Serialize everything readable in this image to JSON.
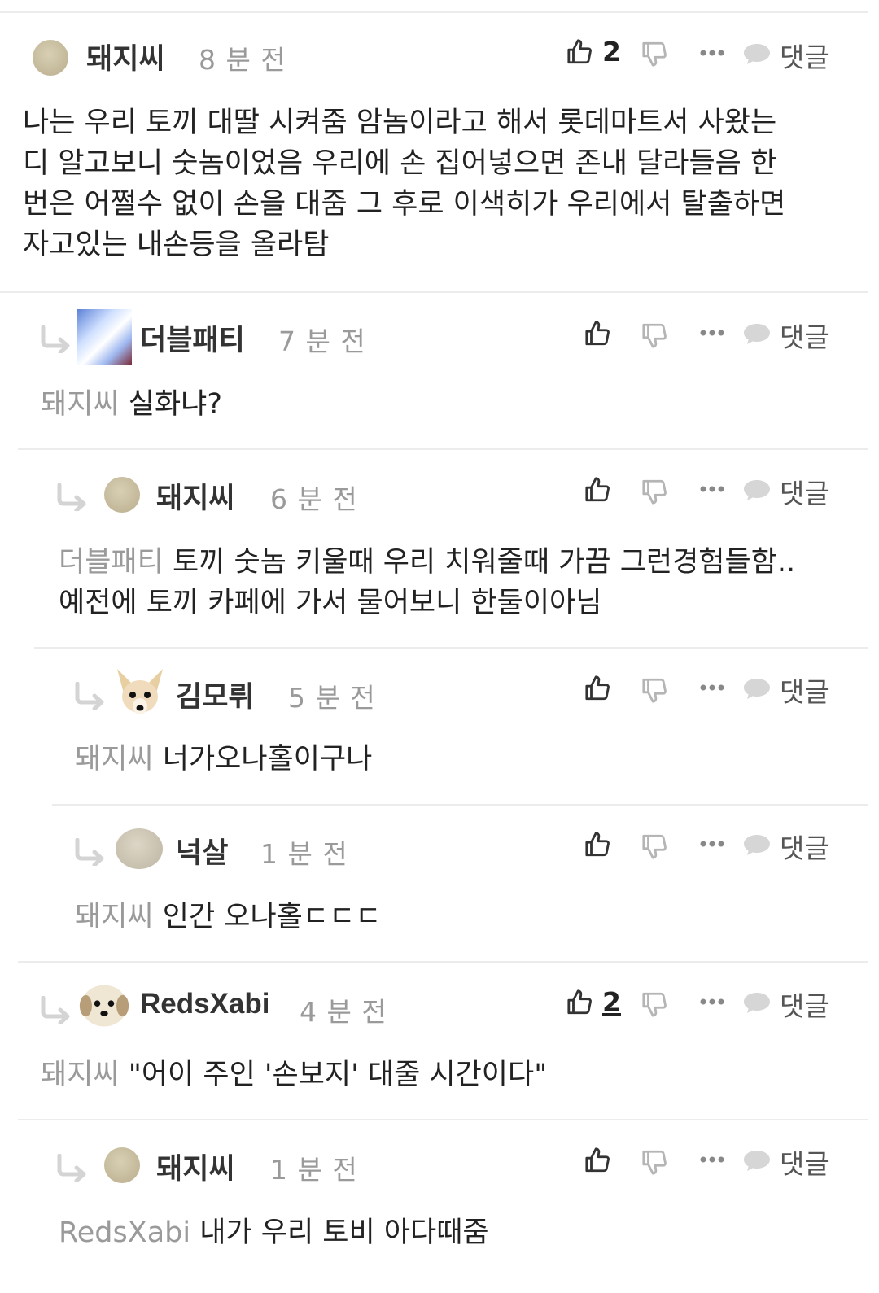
{
  "reply_label": "댓글",
  "comments": [
    {
      "user": "돼지씨",
      "time": "8 분 전",
      "likes": "2",
      "mention": "",
      "text": "나는 우리 토끼 대딸 시켜줌 암놈이라고 해서 롯데마트서 사왔는\n디 알고보니 숫놈이었음 우리에 손 집어넣으면 존내 달라들음 한\n번은 어쩔수 없이 손을 대줌 그 후로 이색히가 우리에서 탈출하면\n자고있는 내손등을 올라탐"
    },
    {
      "user": "더블패티",
      "time": "7 분 전",
      "likes": "",
      "mention": "돼지씨",
      "text": "실화냐?"
    },
    {
      "user": "돼지씨",
      "time": "6 분 전",
      "likes": "",
      "mention": "더블패티",
      "text": "토끼 숫놈 키울때 우리 치워줄때 가끔 그런경험들함..\n예전에 토끼 카페에 가서 물어보니 한둘이아님"
    },
    {
      "user": "김모뤼",
      "time": "5 분 전",
      "likes": "",
      "mention": "돼지씨",
      "text": "너가오나홀이구나"
    },
    {
      "user": "넉살",
      "time": "1 분 전",
      "likes": "",
      "mention": "돼지씨",
      "text": "인간 오나홀ㄷㄷㄷ"
    },
    {
      "user": "RedsXabi",
      "time": "4 분 전",
      "likes": "2",
      "mention": "돼지씨",
      "text": "\"어이 주인 '손보지' 대줄 시간이다\""
    },
    {
      "user": "돼지씨",
      "time": "1 분 전",
      "likes": "",
      "mention": "RedsXabi",
      "text": "내가 우리 토비 아다때줌"
    }
  ],
  "colors": {
    "muted": "#9a9a9a",
    "icon": "#333333",
    "icon_light": "#b5b5b5",
    "divider": "#ececec"
  }
}
